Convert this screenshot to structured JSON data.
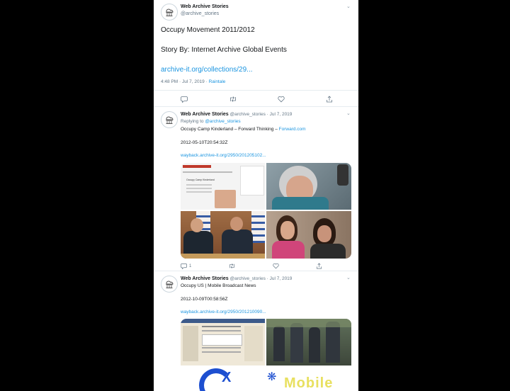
{
  "main_tweet": {
    "author_name": "Web Archive Stories",
    "author_handle": "@archive_stories",
    "line1": "Occupy Movement 2011/2012",
    "line2": "Story By: Internet Archive Global Events",
    "link": "archive-it.org/collections/29...",
    "time": "4:48 PM · Jul 7, 2019 · ",
    "client": "Raintale",
    "actions": [
      "reply-icon",
      "retweet-icon",
      "like-icon",
      "share-icon"
    ]
  },
  "reply1": {
    "author_name": "Web Archive Stories",
    "author_handle": "@archive_stories",
    "date": "· Jul 7, 2019",
    "replying_prefix": "Replying to ",
    "replying_to": "@archive_stories",
    "title": "Occupy Camp Kinderland – Forward Thinking – ",
    "source": "Forward.com",
    "timestamp": "2012-05-10T20:54:32Z",
    "link": "wayback.archive-it.org/2950/201205102...",
    "reply_count": "1",
    "thumb_text": "Occupy Camp Kinderland"
  },
  "reply2": {
    "author_name": "Web Archive Stories",
    "author_handle": "@archive_stories",
    "date": "· Jul 7, 2019",
    "title": "Occupy US | Mobile Broadcast News",
    "timestamp": "2012-10-09T00:58:56Z",
    "link": "wayback.archive-it.org/2950/201210090...",
    "banner_text": "Mobile"
  },
  "colors": {
    "background": "#000000",
    "link": "#1b95e0",
    "secondary_text": "#657786",
    "divider": "#e6ecf0"
  }
}
